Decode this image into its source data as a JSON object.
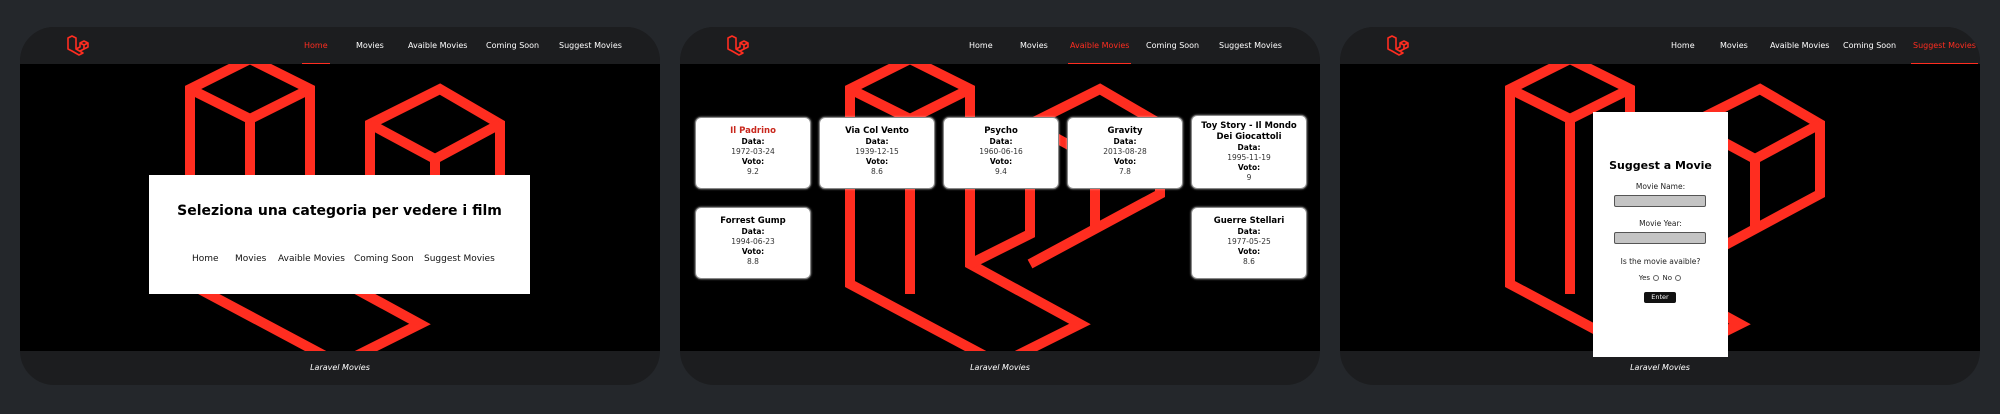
{
  "colors": {
    "page_bg": "#24272b",
    "panel_bg": "#1c1d1f",
    "hero_bg": "#000000",
    "accent": "#ff2d20"
  },
  "nav": {
    "logo_icon": "laravel-logo-icon",
    "items": [
      "Home",
      "Movies",
      "Avaible Movies",
      "Coming Soon",
      "Suggest Movies"
    ]
  },
  "footer": "Laravel Movies",
  "panel1": {
    "title": "Seleziona una categoria per vedere i film",
    "links": [
      "Home",
      "Movies",
      "Avaible Movies",
      "Coming Soon",
      "Suggest Movies"
    ]
  },
  "panel2": {
    "label_date": "Data:",
    "label_vote": "Voto:",
    "movies": [
      {
        "title": "Il Padrino",
        "date": "1972-03-24",
        "vote": "9.2"
      },
      {
        "title": "Via Col Vento",
        "date": "1939-12-15",
        "vote": "8.6"
      },
      {
        "title": "Psycho",
        "date": "1960-06-16",
        "vote": "9.4"
      },
      {
        "title": "Gravity",
        "date": "2013-08-28",
        "vote": "7.8"
      },
      {
        "title": "Toy Story - Il Mondo Dei Giocattoli",
        "date": "1995-11-19",
        "vote": "9"
      },
      {
        "title": "Forrest Gump",
        "date": "1994-06-23",
        "vote": "8.8"
      },
      {
        "title": "Guerre Stellari",
        "date": "1977-05-25",
        "vote": "8.6"
      }
    ]
  },
  "panel3": {
    "title": "Suggest a Movie",
    "name_label": "Movie Name:",
    "name_value": "",
    "year_label": "Movie Year:",
    "year_value": "",
    "available_label": "Is the movie avaible?",
    "yes_label": "Yes",
    "no_label": "No",
    "submit_label": "Enter"
  }
}
